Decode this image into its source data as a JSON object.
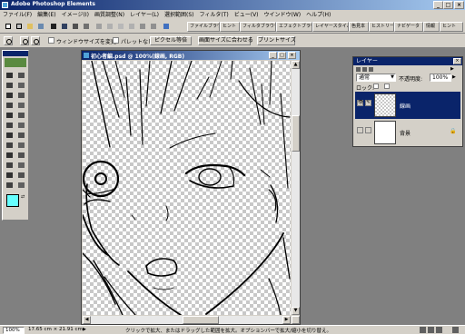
{
  "window": {
    "title": "Adobe Photoshop Elements",
    "buttons": [
      "_",
      "□",
      "×"
    ]
  },
  "menu": [
    "ファイル(F)",
    "編集(E)",
    "イメージ(I)",
    "画質調整(N)",
    "レイヤー(L)",
    "選択範囲(S)",
    "フィルタ(T)",
    "ビュー(V)",
    "ウインドウ(W)",
    "ヘルプ(H)"
  ],
  "palette_well": [
    "ファイルブラウザ",
    "ヒント",
    "フィルタブラウザ",
    "エフェクトブラウザ",
    "レイヤースタイル",
    "色見本",
    "ヒストリー",
    "ナビゲータ",
    "情報",
    "ヒント"
  ],
  "options": {
    "resize_window": "ウィンドウサイズを変更",
    "ignore_palettes": "パレットなし",
    "actual_pixels": "ピクセル等倍",
    "fit_on_screen": "画面サイズに合わせる",
    "print_size": "プリントサイズ"
  },
  "document": {
    "title": "初心者編.psd @ 100%(線画, RGB)"
  },
  "layers_palette": {
    "title": "レイヤー",
    "blend_mode": "通常",
    "opacity_label": "不透明度:",
    "opacity_value": "100%",
    "lock_label": "ロック:",
    "layers": [
      {
        "name": "線画",
        "selected": true,
        "visible": true
      },
      {
        "name": "背景",
        "selected": false,
        "visible": true,
        "locked": true
      }
    ]
  },
  "status": {
    "zoom": "100%",
    "doc_size": "17.65 cm × 21.91 cm",
    "hint": "クリックで拡大、またはドラッグした範囲を拡大。オプションバーで拡大/縮小を切り替え。"
  },
  "colors": {
    "title_start": "#0a246a",
    "title_end": "#a6caf0",
    "foreground_swatch": "#66ffff",
    "background_swatch": "#ffffff",
    "selected_layer": "#0a246a"
  },
  "toolbox": {
    "icons": [
      "move-icon",
      "zoom-icon",
      "marquee-icon",
      "hand-icon",
      "lasso-icon",
      "eyedropper-icon",
      "magic-wand-icon",
      "type-icon",
      "crop-icon",
      "shape-icon",
      "brush-icon",
      "eraser-icon",
      "pencil-icon",
      "stamp-icon",
      "paint-bucket-icon",
      "gradient-icon",
      "blur-icon",
      "sponge-icon",
      "red-eye-icon",
      "dodge-icon",
      "smudge-icon",
      "burn-icon",
      "zoom2-icon",
      "hand2-icon"
    ]
  }
}
